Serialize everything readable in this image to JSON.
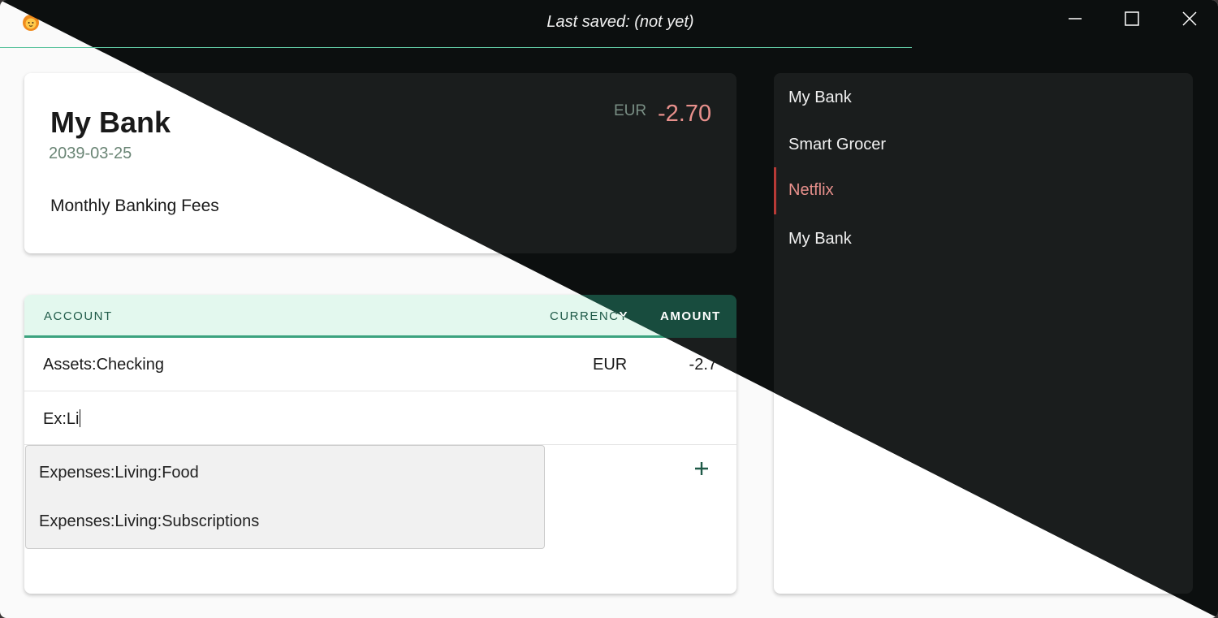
{
  "toolbar": {
    "app_icon": "lion-face-icon",
    "open_icon": "folder-open-icon",
    "save_icon": "floppy-disk-icon",
    "exit_icon": "exit-icon"
  },
  "status": {
    "last_saved": "Last saved: (not yet)"
  },
  "transaction": {
    "title": "My Bank",
    "date": "2039-03-25",
    "description": "Monthly Banking Fees",
    "currency": "EUR",
    "amount": "-2.70"
  },
  "postings": {
    "headers": {
      "account": "ACCOUNT",
      "currency": "CURRENCY",
      "amount": "AMOUNT"
    },
    "rows": [
      {
        "account": "Assets:Checking",
        "currency": "EUR",
        "amount": "-2.7"
      }
    ],
    "input": {
      "value": "Ex:Li"
    }
  },
  "autocomplete": {
    "items": [
      "Expenses:Living:Food",
      "Expenses:Living:Subscriptions"
    ]
  },
  "transaction_list": {
    "items": [
      "My Bank",
      "Smart Grocer",
      "Netflix",
      "My Bank"
    ],
    "active_index": 2
  },
  "colors": {
    "accent": "#3ca37f",
    "negative_amount": "#e8908c",
    "active_marker": "#b83a36"
  }
}
